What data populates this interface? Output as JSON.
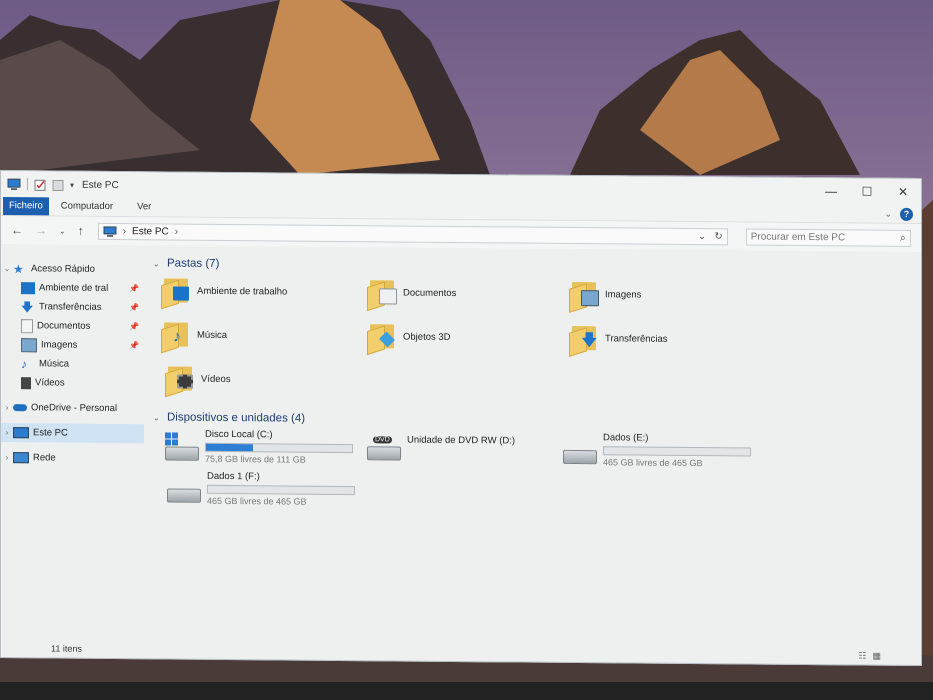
{
  "window": {
    "title": "Este PC",
    "controls": {
      "minimize": "—",
      "maximize": "☐",
      "close": "✕"
    }
  },
  "ribbon": {
    "tabs": [
      "Ficheiro",
      "Computador",
      "Ver"
    ],
    "help": "?"
  },
  "nav": {
    "address": "Este PC",
    "search_placeholder": "Procurar em Este PC"
  },
  "sidebar": {
    "items": [
      {
        "label": "Acesso Rápido",
        "icon": "star-icon",
        "pinned": false
      },
      {
        "label": "Ambiente de tral",
        "icon": "desktop-icon",
        "pinned": true
      },
      {
        "label": "Transferências",
        "icon": "download-icon",
        "pinned": true
      },
      {
        "label": "Documentos",
        "icon": "document-icon",
        "pinned": true
      },
      {
        "label": "Imagens",
        "icon": "image-icon",
        "pinned": true
      },
      {
        "label": "Música",
        "icon": "music-icon",
        "pinned": false
      },
      {
        "label": "Vídeos",
        "icon": "video-icon",
        "pinned": false
      },
      {
        "label": "OneDrive - Personal",
        "icon": "cloud-icon",
        "pinned": false
      },
      {
        "label": "Este PC",
        "icon": "computer-icon",
        "pinned": false
      },
      {
        "label": "Rede",
        "icon": "network-icon",
        "pinned": false
      }
    ]
  },
  "folders": {
    "header": "Pastas (7)",
    "items": [
      {
        "label": "Ambiente de trabalho",
        "color": "#1b73c9"
      },
      {
        "label": "Documentos",
        "color": "#c8d2dc"
      },
      {
        "label": "Imagens",
        "color": "#7aa7cf"
      },
      {
        "label": "Música",
        "color": "#1d6fb8"
      },
      {
        "label": "Objetos 3D",
        "color": "#3aa0e0"
      },
      {
        "label": "Transferências",
        "color": "#1f74cc"
      },
      {
        "label": "Vídeos",
        "color": "#3b3b3b"
      }
    ]
  },
  "drives": {
    "header": "Dispositivos e unidades (4)",
    "items": [
      {
        "label": "Disco Local (C:)",
        "free": "75,8 GB livres de 111 GB",
        "used_fraction": 0.32
      },
      {
        "label": "Unidade de DVD RW (D:)",
        "free": "",
        "used_fraction": null,
        "badge": "DVD"
      },
      {
        "label": "Dados (E:)",
        "free": "465 GB livres de 465 GB",
        "used_fraction": 0.0
      },
      {
        "label": "Dados 1 (F:)",
        "free": "465 GB livres de 465 GB",
        "used_fraction": 0.0
      }
    ]
  },
  "status": {
    "count": "11 itens"
  }
}
